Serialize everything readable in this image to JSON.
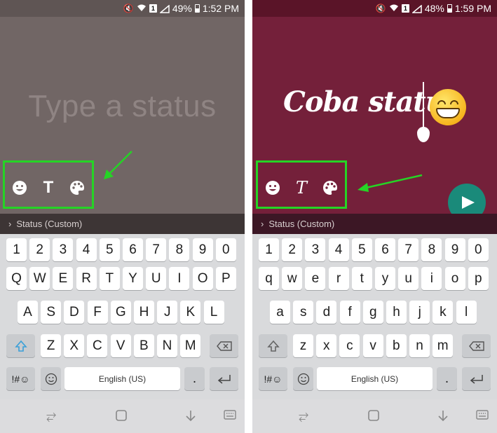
{
  "left": {
    "status_bar": {
      "battery": "49%",
      "time": "1:52 PM",
      "sim": "1"
    },
    "placeholder": "Type a status",
    "tools": [
      {
        "icon": "emoji-icon",
        "label": ""
      },
      {
        "icon": "text-style-icon",
        "label": "T"
      },
      {
        "icon": "palette-icon",
        "label": ""
      }
    ],
    "custom_row": "Status (Custom)"
  },
  "right": {
    "status_bar": {
      "battery": "48%",
      "time": "1:59 PM",
      "sim": "1"
    },
    "typed_text": "Coba status",
    "tools": [
      {
        "icon": "emoji-icon",
        "label": ""
      },
      {
        "icon": "text-style-icon",
        "label": "T"
      },
      {
        "icon": "palette-icon",
        "label": ""
      }
    ],
    "custom_row": "Status (Custom)",
    "send_icon": "send-icon"
  },
  "keyboard_left": {
    "numbers": [
      "1",
      "2",
      "3",
      "4",
      "5",
      "6",
      "7",
      "8",
      "9",
      "0"
    ],
    "row1": [
      "Q",
      "W",
      "E",
      "R",
      "T",
      "Y",
      "U",
      "I",
      "O",
      "P"
    ],
    "row2": [
      "A",
      "S",
      "D",
      "F",
      "G",
      "H",
      "J",
      "K",
      "L"
    ],
    "row3": [
      "Z",
      "X",
      "C",
      "V",
      "B",
      "N",
      "M"
    ],
    "sym": "!#☺",
    "space": "English (US)",
    "period": "."
  },
  "keyboard_right": {
    "numbers": [
      "1",
      "2",
      "3",
      "4",
      "5",
      "6",
      "7",
      "8",
      "9",
      "0"
    ],
    "row1": [
      "q",
      "w",
      "e",
      "r",
      "t",
      "y",
      "u",
      "i",
      "o",
      "p"
    ],
    "row2": [
      "a",
      "s",
      "d",
      "f",
      "g",
      "h",
      "j",
      "k",
      "l"
    ],
    "row3": [
      "z",
      "x",
      "c",
      "v",
      "b",
      "n",
      "m"
    ],
    "sym": "!#☺",
    "space": "English (US)",
    "period": "."
  },
  "colors": {
    "left_bg": "#716665",
    "right_bg": "#74203a",
    "highlight": "#25d425",
    "fab": "#1a8a7a"
  }
}
